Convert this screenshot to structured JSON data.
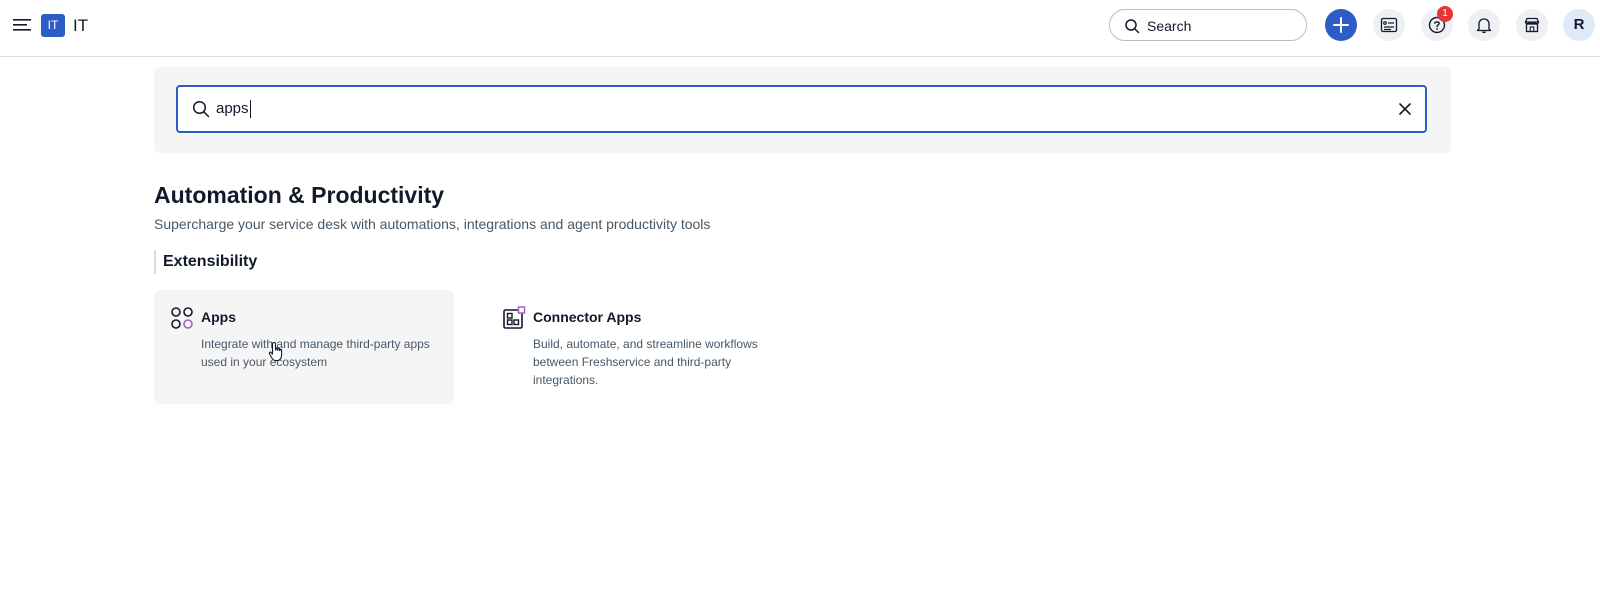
{
  "topbar": {
    "workspace_badge": "IT",
    "workspace_name": "IT",
    "search_label": "Search",
    "notification_count": "1",
    "avatar_initial": "R",
    "icons": [
      "hamburger-menu-icon",
      "search-icon",
      "plus-icon",
      "todo-list-icon",
      "help-icon",
      "bell-icon",
      "store-icon"
    ],
    "colors": {
      "brand": "#2c5cc5",
      "badge": "#e43538"
    }
  },
  "search": {
    "value": "apps"
  },
  "section": {
    "title": "Automation & Productivity",
    "subtitle": "Supercharge your service desk with automations, integrations and agent productivity tools",
    "group": "Extensibility"
  },
  "cards": [
    {
      "title": "Apps",
      "description": "Integrate with and manage third-party apps used in your ecosystem",
      "icon": "apps-grid-icon"
    },
    {
      "title": "Connector Apps",
      "description": "Build, automate, and streamline workflows between Freshservice and third-party integrations.",
      "icon": "connector-apps-icon"
    }
  ]
}
